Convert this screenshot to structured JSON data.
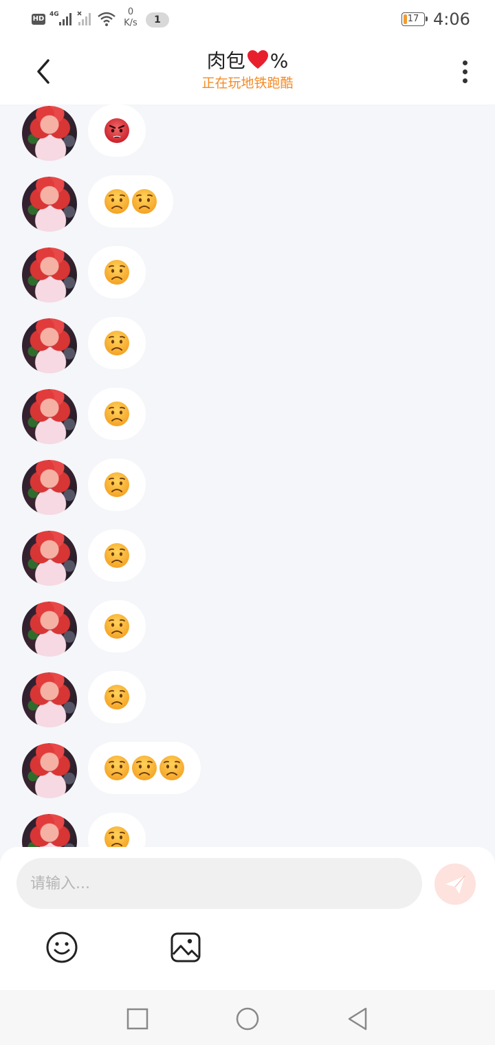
{
  "status_bar": {
    "hd": "HD",
    "network": "4G",
    "speed_value": "0",
    "speed_unit": "K/s",
    "notification_count": "1",
    "battery": "17",
    "time": "4:06"
  },
  "header": {
    "title_prefix": "肉包",
    "title_suffix": "%",
    "status": "正在玩地铁跑酷",
    "accent_color": "#f58a23"
  },
  "messages": [
    {
      "emojis": [
        "pouting-face"
      ]
    },
    {
      "emojis": [
        "worried-face",
        "worried-face"
      ]
    },
    {
      "emojis": [
        "worried-face"
      ]
    },
    {
      "emojis": [
        "worried-face"
      ]
    },
    {
      "emojis": [
        "worried-face"
      ]
    },
    {
      "emojis": [
        "worried-face"
      ]
    },
    {
      "emojis": [
        "worried-face"
      ]
    },
    {
      "emojis": [
        "worried-face"
      ]
    },
    {
      "emojis": [
        "worried-face"
      ]
    },
    {
      "emojis": [
        "worried-face",
        "worried-face",
        "worried-face"
      ]
    },
    {
      "emojis": [
        "worried-face"
      ]
    }
  ],
  "input": {
    "placeholder": "请输入...",
    "value": ""
  },
  "icons": {
    "back": "chevron-left-icon",
    "more": "more-vertical-icon",
    "send": "send-icon",
    "emoji": "smiley-icon",
    "image": "image-icon",
    "nav_recent": "square-icon",
    "nav_home": "circle-icon",
    "nav_back": "triangle-back-icon"
  }
}
